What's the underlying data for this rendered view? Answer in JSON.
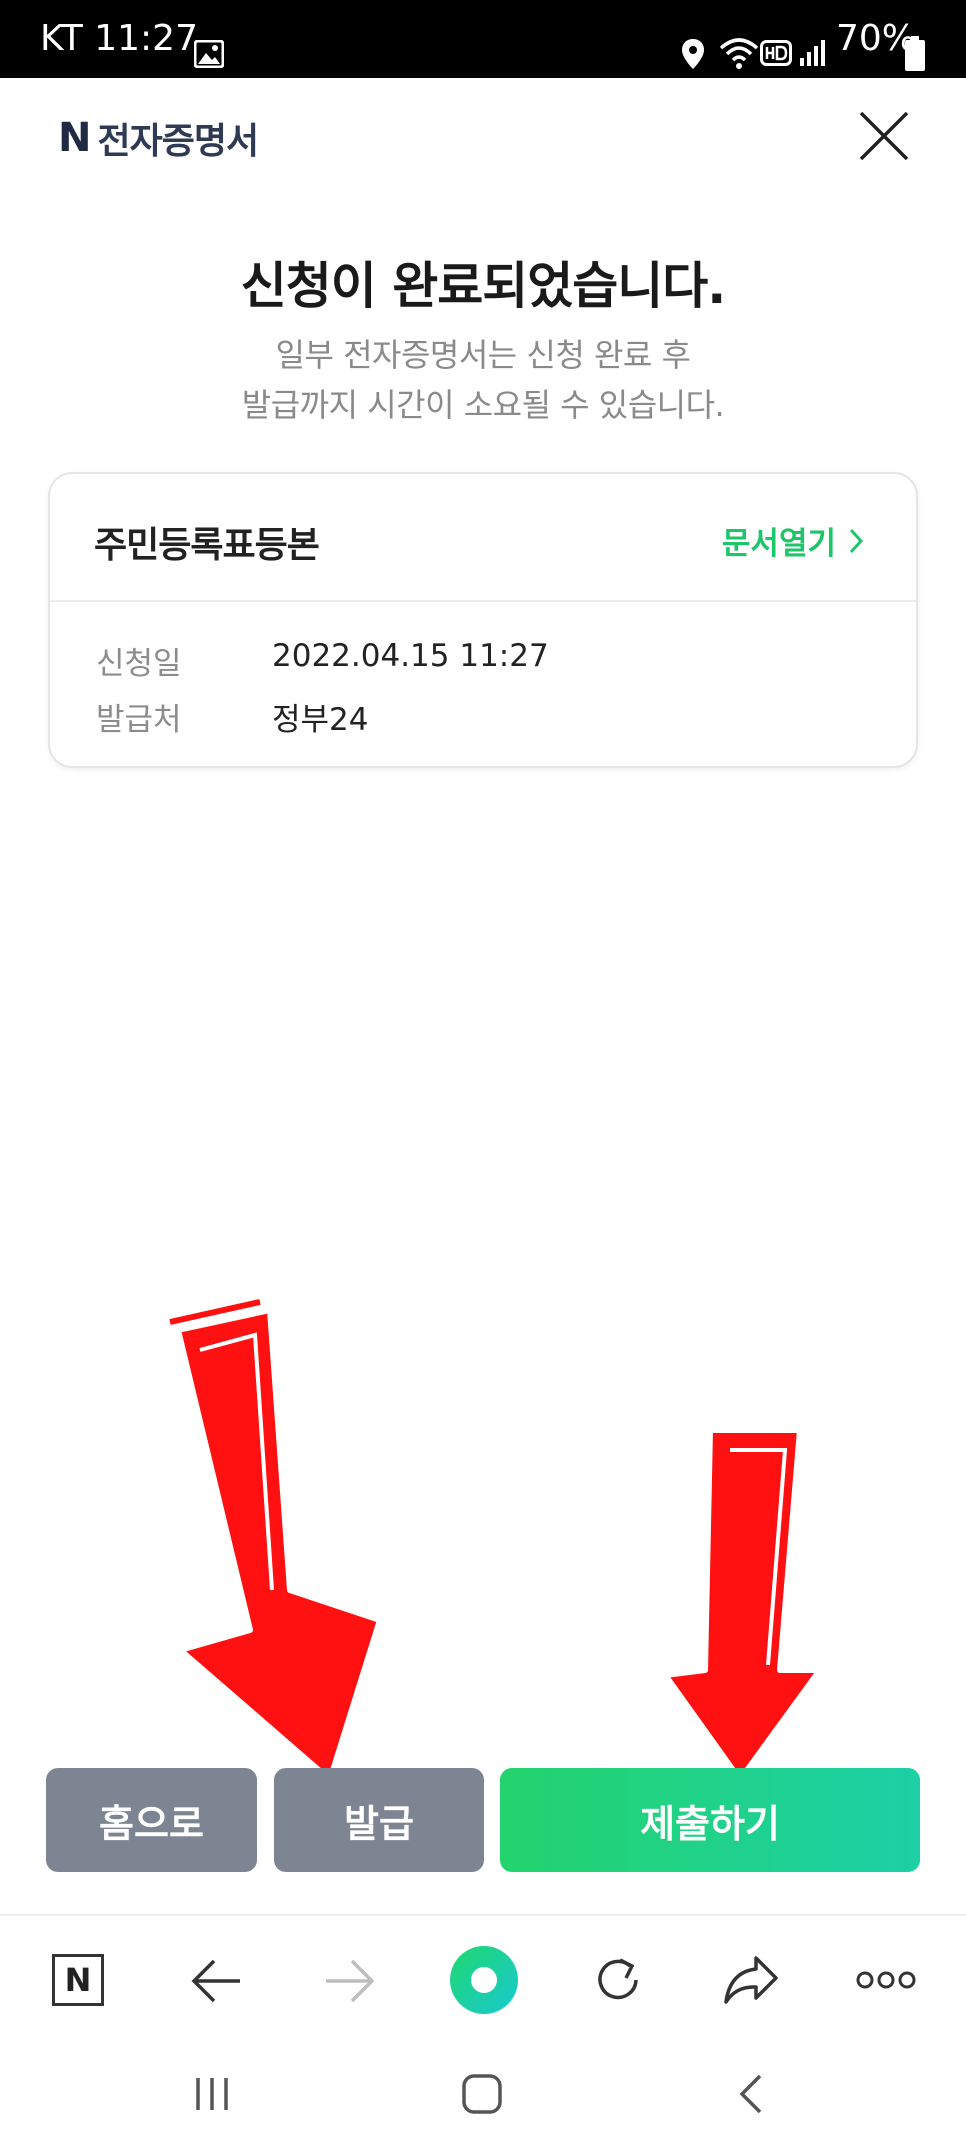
{
  "status_bar": {
    "carrier_time": "KT 11:27",
    "battery": "70%"
  },
  "header": {
    "logo_mark": "N",
    "logo_text": "전자증명서"
  },
  "main": {
    "title": "신청이 완료되었습니다.",
    "subtitle_line1": "일부 전자증명서는 신청 완료 후",
    "subtitle_line2": "발급까지 시간이 소요될 수 있습니다."
  },
  "card": {
    "doc_title": "주민등록표등본",
    "open_link": "문서열기",
    "rows": [
      {
        "label": "신청일",
        "value": "2022.04.15 11:27"
      },
      {
        "label": "발급처",
        "value": "정부24"
      }
    ]
  },
  "buttons": {
    "home": "홈으로",
    "issue": "발급",
    "submit": "제출하기"
  },
  "toolbar": {
    "naver_label": "N"
  },
  "colors": {
    "accent_green": "#1ec66a",
    "button_gray": "#7d8492",
    "annotation_red": "#ff1010"
  }
}
